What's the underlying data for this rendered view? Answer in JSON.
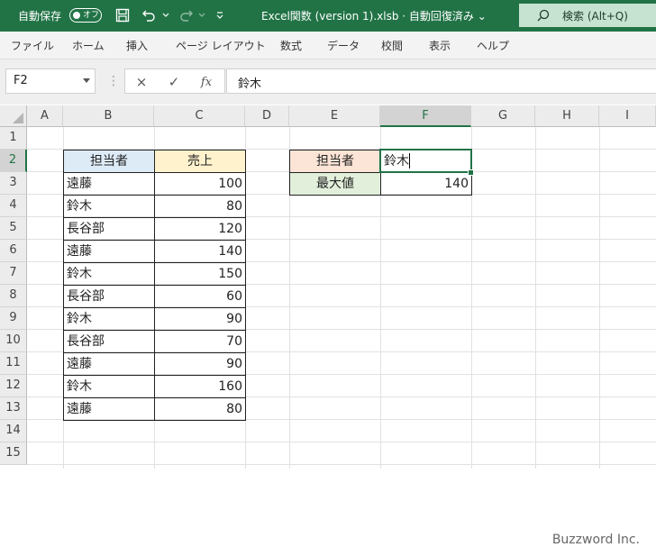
{
  "titlebar": {
    "autosave_label": "自動保存",
    "autosave_state": "オフ",
    "filename": "Excel関数 (version 1).xlsb  ·  自動回復済み  ⌄",
    "search_label": "検索 (Alt+Q)",
    "accent": "#217346"
  },
  "menu": [
    "ファイル",
    "ホーム",
    "挿入",
    "ページ レイアウト",
    "数式",
    "データ",
    "校閲",
    "表示",
    "ヘルプ"
  ],
  "formula_bar": {
    "name_box": "F2",
    "cancel_icon": "×",
    "enter_icon": "✓",
    "fx_label": "fx",
    "formula": "鈴木"
  },
  "columns": [
    "A",
    "B",
    "C",
    "D",
    "E",
    "F",
    "G",
    "H",
    "I"
  ],
  "rows": [
    "1",
    "2",
    "3",
    "4",
    "5",
    "6",
    "7",
    "8",
    "9",
    "10",
    "11",
    "12",
    "13",
    "14",
    "15"
  ],
  "selected": {
    "column": "F",
    "row": "2"
  },
  "table": {
    "headers": [
      "担当者",
      "売上"
    ],
    "rows": [
      [
        "遠藤",
        "100"
      ],
      [
        "鈴木",
        "80"
      ],
      [
        "長谷部",
        "120"
      ],
      [
        "遠藤",
        "140"
      ],
      [
        "鈴木",
        "150"
      ],
      [
        "長谷部",
        "60"
      ],
      [
        "鈴木",
        "90"
      ],
      [
        "長谷部",
        "70"
      ],
      [
        "遠藤",
        "90"
      ],
      [
        "鈴木",
        "160"
      ],
      [
        "遠藤",
        "80"
      ]
    ]
  },
  "lookup": {
    "label1": "担当者",
    "value1": "鈴木",
    "label2": "最大値",
    "value2": "140"
  },
  "watermark": "Buzzword Inc."
}
